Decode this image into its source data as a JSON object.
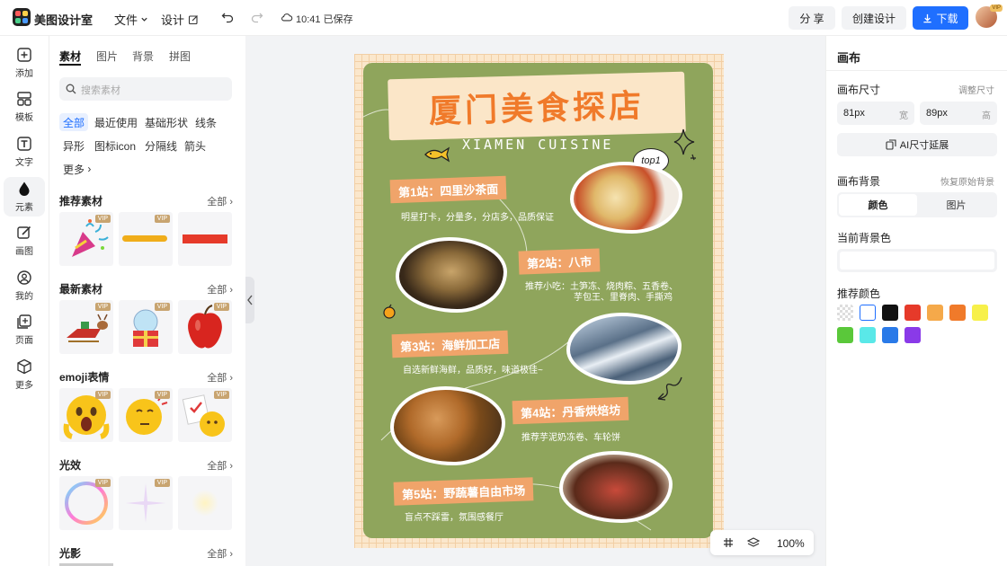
{
  "app": {
    "name": "美图设计室"
  },
  "topbar": {
    "menu_file": "文件",
    "menu_design": "设计",
    "saved_status": "10:41 已保存",
    "share_label": "分 享",
    "create_label": "创建设计",
    "download_label": "下载",
    "avatar_badge": "VIP"
  },
  "rail": {
    "items": [
      {
        "label": "添加",
        "icon": "plus-square-icon"
      },
      {
        "label": "模板",
        "icon": "template-grid-icon"
      },
      {
        "label": "文字",
        "icon": "text-icon"
      },
      {
        "label": "元素",
        "icon": "shapes-icon"
      },
      {
        "label": "画图",
        "icon": "pen-icon"
      },
      {
        "label": "我的",
        "icon": "user-icon"
      },
      {
        "label": "页面",
        "icon": "page-add-icon"
      },
      {
        "label": "更多",
        "icon": "cube-icon"
      }
    ]
  },
  "panel": {
    "tabs": [
      "素材",
      "图片",
      "背景",
      "拼图"
    ],
    "search_placeholder": "搜索素材",
    "chips": [
      "全部",
      "最近使用",
      "基础形状",
      "线条",
      "异形",
      "图标icon",
      "分隔线",
      "箭头"
    ],
    "more_label": "更多",
    "all_label": "全部",
    "vip_label": "VIP",
    "sections": [
      "推荐素材",
      "最新素材",
      "emoji表情",
      "光效",
      "光影"
    ]
  },
  "poster": {
    "title": "厦门美食探店",
    "subtitle": "XIAMEN CUISINE",
    "badge": "top1",
    "stations": [
      {
        "title": "第1站：四里沙茶面",
        "desc": "明星打卡，分量多，分店多，品质保证"
      },
      {
        "title": "第2站：八市",
        "desc": "推荐小吃：土笋冻、烧肉粽、五香卷、",
        "desc2": "芋包王、里脊肉、手撕鸡"
      },
      {
        "title": "第3站：海鲜加工店",
        "desc": "自选新鲜海鲜，品质好，味道极佳~"
      },
      {
        "title": "第4站：丹香烘焙坊",
        "desc": "推荐芋泥奶冻卷、车轮饼"
      },
      {
        "title": "第5站：野蔬薯自由市场",
        "desc": "盲点不踩雷，氛围感餐厅"
      }
    ]
  },
  "zoombar": {
    "zoom": "100%"
  },
  "right": {
    "title": "画布",
    "size_label": "画布尺寸",
    "adjust_label": "调整尺寸",
    "width_value": "81px",
    "width_unit": "宽",
    "height_value": "89px",
    "height_unit": "高",
    "ai_extend": "AI尺寸延展",
    "bg_label": "画布背景",
    "restore_label": "恢复原始背景",
    "bg_tabs": [
      "颜色",
      "图片"
    ],
    "current_bg_label": "当前背景色",
    "recommended_label": "推荐颜色",
    "swatches": [
      "#ffffff",
      "#111111",
      "#e63a2a",
      "#f5a94a",
      "#f07a2a",
      "#f7f04a",
      "#5ac83a",
      "#5ae8e8",
      "#2a7ae8",
      "#8a3ae8"
    ]
  }
}
